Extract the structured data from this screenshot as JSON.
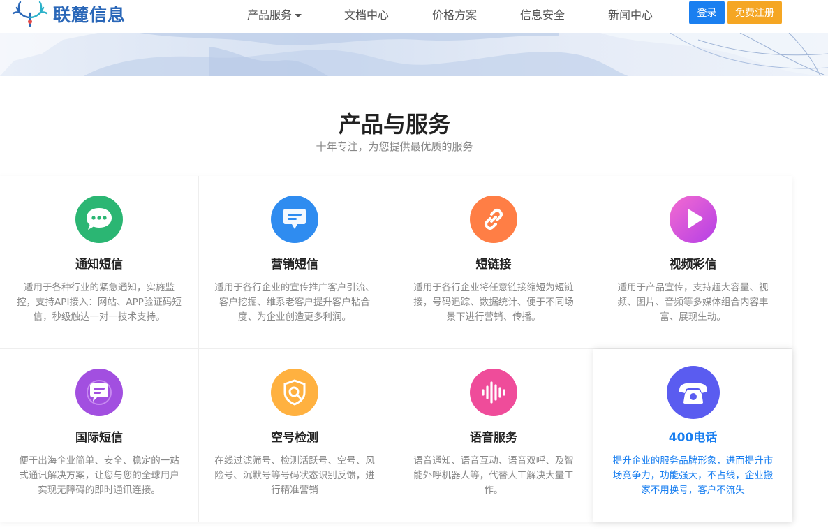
{
  "brand": {
    "name": "联麓信息",
    "color": "#2a67b8"
  },
  "nav": {
    "items": [
      {
        "label": "产品服务",
        "has_dropdown": true
      },
      {
        "label": "文档中心"
      },
      {
        "label": "价格方案"
      },
      {
        "label": "信息安全"
      },
      {
        "label": "新闻中心"
      }
    ],
    "login_label": "登录",
    "register_label": "免费注册"
  },
  "section": {
    "title": "产品与服务",
    "subtitle": "十年专注，为您提供最优质的服务"
  },
  "products": [
    {
      "title": "通知短信",
      "desc": "适用于各种行业的紧急通知，实施监控，支持API接入：网站、APP验证码短信，秒级触达一对一技术支持。",
      "icon": "chat-bubble-icon",
      "color": "#2bb673"
    },
    {
      "title": "营销短信",
      "desc": "适用于各行企业的宣传推广客户引流、客户挖掘、维系老客户提升客户粘合度、为企业创造更多利润。",
      "icon": "message-icon",
      "color": "#2f8cf0"
    },
    {
      "title": "短链接",
      "desc": "适用于各行企业将任意链接缩短为短链接，号码追踪、数据统计、便于不同场景下进行营销、传播。",
      "icon": "link-icon",
      "color": "#ff7e45"
    },
    {
      "title": "视频彩信",
      "desc": "适用于产品宣传，支持超大容量、视频、图片、音频等多媒体组合内容丰富、展现生动。",
      "icon": "play-icon",
      "color": "#e04fd6"
    },
    {
      "title": "国际短信",
      "desc": "便于出海企业简单、安全、稳定的一站式通讯解决方案，让您与您的全球用户实现无障碍的即时通讯连接。",
      "icon": "globe-message-icon",
      "color": "#a24fe0"
    },
    {
      "title": "空号检测",
      "desc": "在线过滤筛号、检测活跃号、空号、风险号、沉默号等号码状态识别反馈，进行精准营销",
      "icon": "shield-search-icon",
      "color": "#ffb140"
    },
    {
      "title": "语音服务",
      "desc": "语音通知、语音互动、语音双呼、及智能外呼机器人等，代替人工解决大量工作。",
      "icon": "voice-wave-icon",
      "color": "#ef4c9a"
    },
    {
      "title": "400电话",
      "desc": "提升企业的服务品牌形象，进而提升市场竞争力，功能强大，不占线，企业搬家不用换号，客户不流失",
      "icon": "telephone-icon",
      "color": "#5a5cf0"
    }
  ]
}
